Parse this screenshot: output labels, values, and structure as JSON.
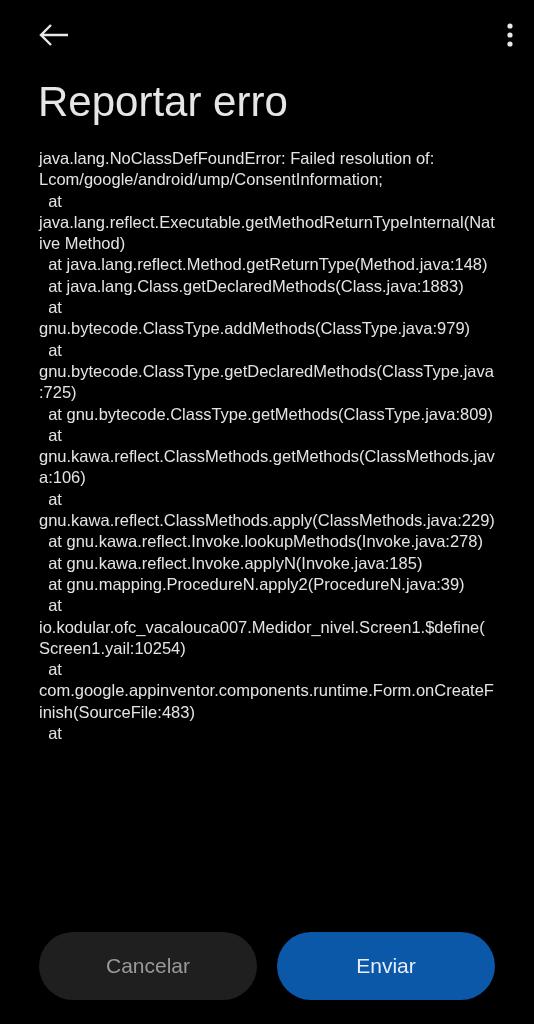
{
  "title": "Reportar erro",
  "error_text": "java.lang.NoClassDefFoundError: Failed resolution of: Lcom/google/android/ump/ConsentInformation;\n  at java.lang.reflect.Executable.getMethodReturnTypeInternal(Native Method)\n  at java.lang.reflect.Method.getReturnType(Method.java:148)\n  at java.lang.Class.getDeclaredMethods(Class.java:1883)\n  at gnu.bytecode.ClassType.addMethods(ClassType.java:979)\n  at gnu.bytecode.ClassType.getDeclaredMethods(ClassType.java:725)\n  at gnu.bytecode.ClassType.getMethods(ClassType.java:809)\n  at gnu.kawa.reflect.ClassMethods.getMethods(ClassMethods.java:106)\n  at gnu.kawa.reflect.ClassMethods.apply(ClassMethods.java:229)\n  at gnu.kawa.reflect.Invoke.lookupMethods(Invoke.java:278)\n  at gnu.kawa.reflect.Invoke.applyN(Invoke.java:185)\n  at gnu.mapping.ProcedureN.apply2(ProcedureN.java:39)\n  at io.kodular.ofc_vacalouca007.Medidor_nivel.Screen1.$define(Screen1.yail:10254)\n  at com.google.appinventor.components.runtime.Form.onCreateFinish(SourceFile:483)\n  at",
  "buttons": [
    {
      "label": "Cancelar",
      "kind": "secondary"
    },
    {
      "label": "Enviar",
      "kind": "primary"
    }
  ]
}
